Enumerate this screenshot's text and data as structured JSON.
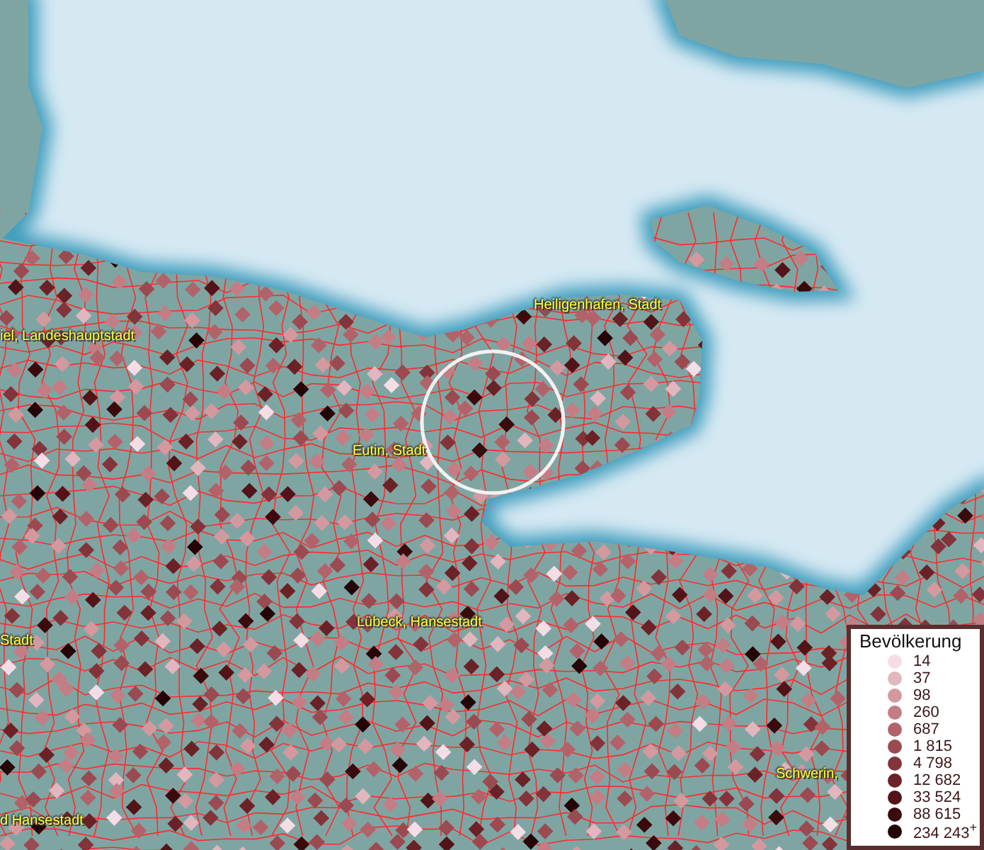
{
  "map": {
    "labels": [
      {
        "text": "iel, Landeshauptstadt"
      },
      {
        "text": "Heiligenhafen, Stadt"
      },
      {
        "text": "Eutin, Stadt"
      },
      {
        "text": "Stadt"
      },
      {
        "text": "Lübeck, Hansestadt"
      },
      {
        "text": "Schwerin,"
      },
      {
        "text": "d Hansestadt"
      }
    ]
  },
  "legend": {
    "title": "Bevölkerung",
    "items": [
      {
        "label": "14",
        "color": "#f5dde6"
      },
      {
        "label": "37",
        "color": "#e2b6bf"
      },
      {
        "label": "98",
        "color": "#d4999f"
      },
      {
        "label": "260",
        "color": "#c47d84"
      },
      {
        "label": "687",
        "color": "#b2636a"
      },
      {
        "label": "1 815",
        "color": "#9a4a50"
      },
      {
        "label": "4 798",
        "color": "#82343a"
      },
      {
        "label": "12 682",
        "color": "#6a2227"
      },
      {
        "label": "33 524",
        "color": "#521418"
      },
      {
        "label": "88 615",
        "color": "#3a0a0d"
      },
      {
        "label": "234 243$^{+}$",
        "color": "#240406"
      }
    ]
  }
}
